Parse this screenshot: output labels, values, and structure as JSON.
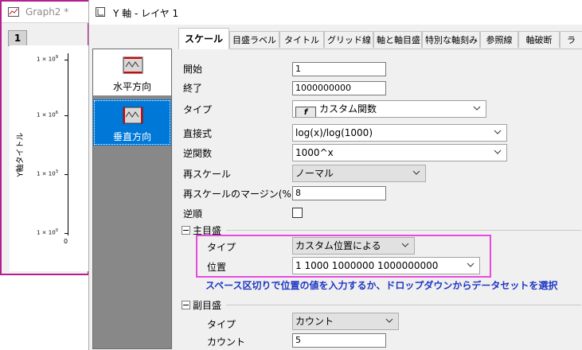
{
  "graph_window": {
    "title": "Graph2 *",
    "layer_number": "1",
    "y_axis_title": "Y軸タイトル",
    "y_ticks": [
      {
        "base": "1 × 10",
        "exp": "9"
      },
      {
        "base": "1 × 10",
        "exp": "6"
      },
      {
        "base": "1 × 10",
        "exp": "3"
      },
      {
        "base": "1 × 10",
        "exp": "0"
      }
    ],
    "x_zero": "0"
  },
  "dialog": {
    "title": "Y 軸 - レイヤ 1",
    "left_panel": {
      "items": [
        {
          "label": "水平方向",
          "selected": false
        },
        {
          "label": "垂直方向",
          "selected": true
        }
      ]
    },
    "tabs": [
      {
        "label": "スケール",
        "active": true
      },
      {
        "label": "目盛ラベル"
      },
      {
        "label": "タイトル"
      },
      {
        "label": "グリッド線"
      },
      {
        "label": "軸と軸目盛"
      },
      {
        "label": "特別な軸刻み"
      },
      {
        "label": "参照線"
      },
      {
        "label": "軸破断"
      },
      {
        "label": "ラ"
      }
    ],
    "scale": {
      "start_label": "開始",
      "start_value": "1",
      "end_label": "終了",
      "end_value": "1000000000",
      "type_label": "タイプ",
      "type_value": "カスタム関数",
      "direct_label": "直接式",
      "direct_value": "log(x)/log(1000)",
      "inverse_label": "逆関数",
      "inverse_value": "1000^x",
      "rescale_label": "再スケール",
      "rescale_value": "ノーマル",
      "rescale_margin_label": "再スケールのマージン(%)",
      "rescale_margin_value": "8",
      "reverse_label": "逆順",
      "reverse_checked": false,
      "major_section": "主目盛",
      "major_type_label": "タイプ",
      "major_type_value": "カスタム位置による",
      "major_position_label": "位置",
      "major_position_value": "1 1000 1000000 1000000000",
      "hint": "スペース区切りで位置の値を入力するか、ドロップダウンからデータセットを選択",
      "minor_section": "副目盛",
      "minor_type_label": "タイプ",
      "minor_type_value": "カウント",
      "minor_count_label": "カウント",
      "minor_count_value": "5"
    }
  },
  "colors": {
    "graph_border": "#b41e8e",
    "selection": "#0078d7",
    "highlight_box": "#e84bdc",
    "hint_text": "#1f36c4"
  }
}
